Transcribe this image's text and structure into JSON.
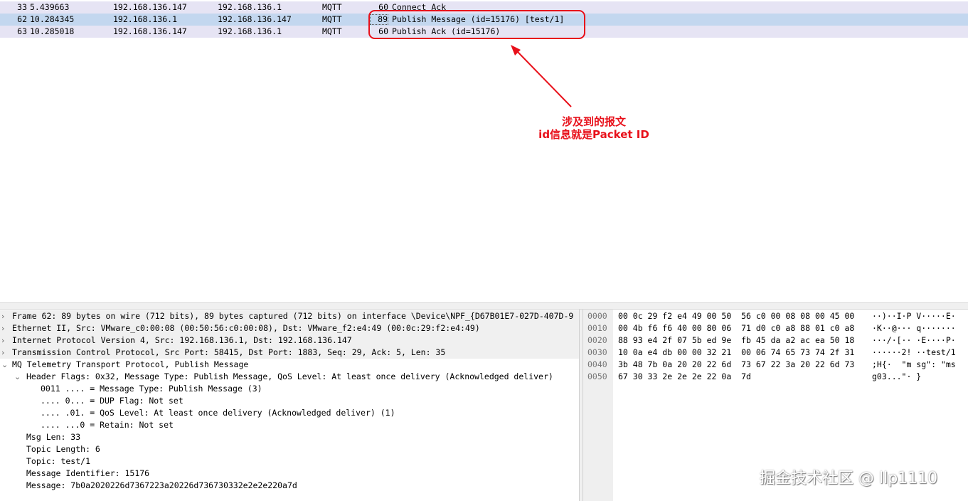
{
  "packet_list": {
    "rows": [
      {
        "no": "33",
        "time": "5.439663",
        "src": "192.168.136.147",
        "dst": "192.168.136.1",
        "proto": "MQTT",
        "len": "60",
        "info": "Connect Ack"
      },
      {
        "no": "62",
        "time": "10.284345",
        "src": "192.168.136.1",
        "dst": "192.168.136.147",
        "proto": "MQTT",
        "len": "89",
        "info": "Publish Message (id=15176) [test/1]"
      },
      {
        "no": "63",
        "time": "10.285018",
        "src": "192.168.136.147",
        "dst": "192.168.136.1",
        "proto": "MQTT",
        "len": "60",
        "info": "Publish Ack (id=15176)"
      }
    ]
  },
  "annotation": {
    "line1": "涉及到的报文",
    "line2": "id信息就是Packet ID",
    "color": "#e8101a"
  },
  "details": {
    "rows": [
      {
        "text": "Frame 62: 89 bytes on wire (712 bits), 89 bytes captured (712 bits) on interface \\Device\\NPF_{D67B01E7-027D-407D-9",
        "arrow": ">"
      },
      {
        "text": "Ethernet II, Src: VMware_c0:00:08 (00:50:56:c0:00:08), Dst: VMware_f2:e4:49 (00:0c:29:f2:e4:49)",
        "arrow": ">"
      },
      {
        "text": "Internet Protocol Version 4, Src: 192.168.136.1, Dst: 192.168.136.147",
        "arrow": ">"
      },
      {
        "text": "Transmission Control Protocol, Src Port: 58415, Dst Port: 1883, Seq: 29, Ack: 5, Len: 35",
        "arrow": ">"
      },
      {
        "text": "MQ Telemetry Transport Protocol, Publish Message",
        "arrow": "v"
      },
      {
        "text": "Header Flags: 0x32, Message Type: Publish Message, QoS Level: At least once delivery (Acknowledged deliver)",
        "arrow": "v"
      },
      {
        "text": "0011 .... = Message Type: Publish Message (3)",
        "arrow": ""
      },
      {
        "text": ".... 0... = DUP Flag: Not set",
        "arrow": ""
      },
      {
        "text": ".... .01. = QoS Level: At least once delivery (Acknowledged deliver) (1)",
        "arrow": ""
      },
      {
        "text": ".... ...0 = Retain: Not set",
        "arrow": ""
      },
      {
        "text": "Msg Len: 33",
        "arrow": ""
      },
      {
        "text": "Topic Length: 6",
        "arrow": ""
      },
      {
        "text": "Topic: test/1",
        "arrow": ""
      },
      {
        "text": "Message Identifier: 15176",
        "arrow": ""
      },
      {
        "text": "Message: 7b0a2020226d7367223a20226d736730332e2e2e220a7d",
        "arrow": ""
      }
    ]
  },
  "bytes": {
    "rows": [
      {
        "off": "0000",
        "hex": "00 0c 29 f2 e4 49 00 50  56 c0 00 08 08 00 45 00",
        "ascii": "··)··I·P V·····E·"
      },
      {
        "off": "0010",
        "hex": "00 4b f6 f6 40 00 80 06  71 d0 c0 a8 88 01 c0 a8",
        "ascii": "·K··@··· q·······"
      },
      {
        "off": "0020",
        "hex": "88 93 e4 2f 07 5b ed 9e  fb 45 da a2 ac ea 50 18",
        "ascii": "···/·[·· ·E····P·"
      },
      {
        "off": "0030",
        "hex": "10 0a e4 db 00 00 32 21  00 06 74 65 73 74 2f 31",
        "ascii": "······2! ··test/1"
      },
      {
        "off": "0040",
        "hex": "3b 48 7b 0a 20 20 22 6d  73 67 22 3a 20 22 6d 73",
        "ascii": ";H{·  \"m sg\": \"ms"
      },
      {
        "off": "0050",
        "hex": "67 30 33 2e 2e 2e 22 0a  7d",
        "ascii": "g03...\"· }"
      }
    ]
  },
  "watermark": "掘金技术社区 @ llp1110"
}
